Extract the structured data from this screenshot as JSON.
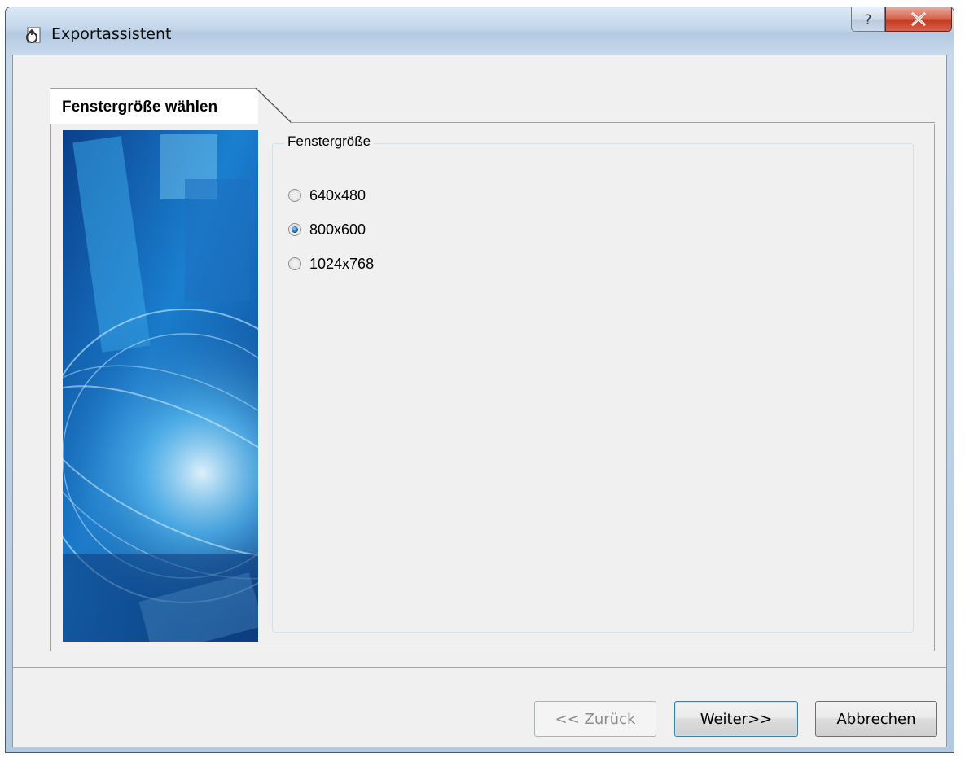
{
  "window": {
    "title": "Exportassistent",
    "app_icon": "export-wizard-icon",
    "help_icon": "question-icon",
    "close_icon": "close-icon"
  },
  "tab": {
    "label": "Fenstergröße wählen"
  },
  "sidebar": {
    "image": "abstract-blue-globe-image"
  },
  "window_size_group": {
    "legend": "Fenstergröße",
    "options": [
      {
        "label": "640x480",
        "checked": false
      },
      {
        "label": "800x600",
        "checked": true
      },
      {
        "label": "1024x768",
        "checked": false
      }
    ]
  },
  "buttons": {
    "back": "<< Zurück",
    "next": "Weiter>>",
    "cancel": "Abbrechen"
  },
  "colors": {
    "titlebar": "#c3d6ea",
    "close_button": "#c1371c",
    "dialog_background": "#f0f0f0"
  }
}
